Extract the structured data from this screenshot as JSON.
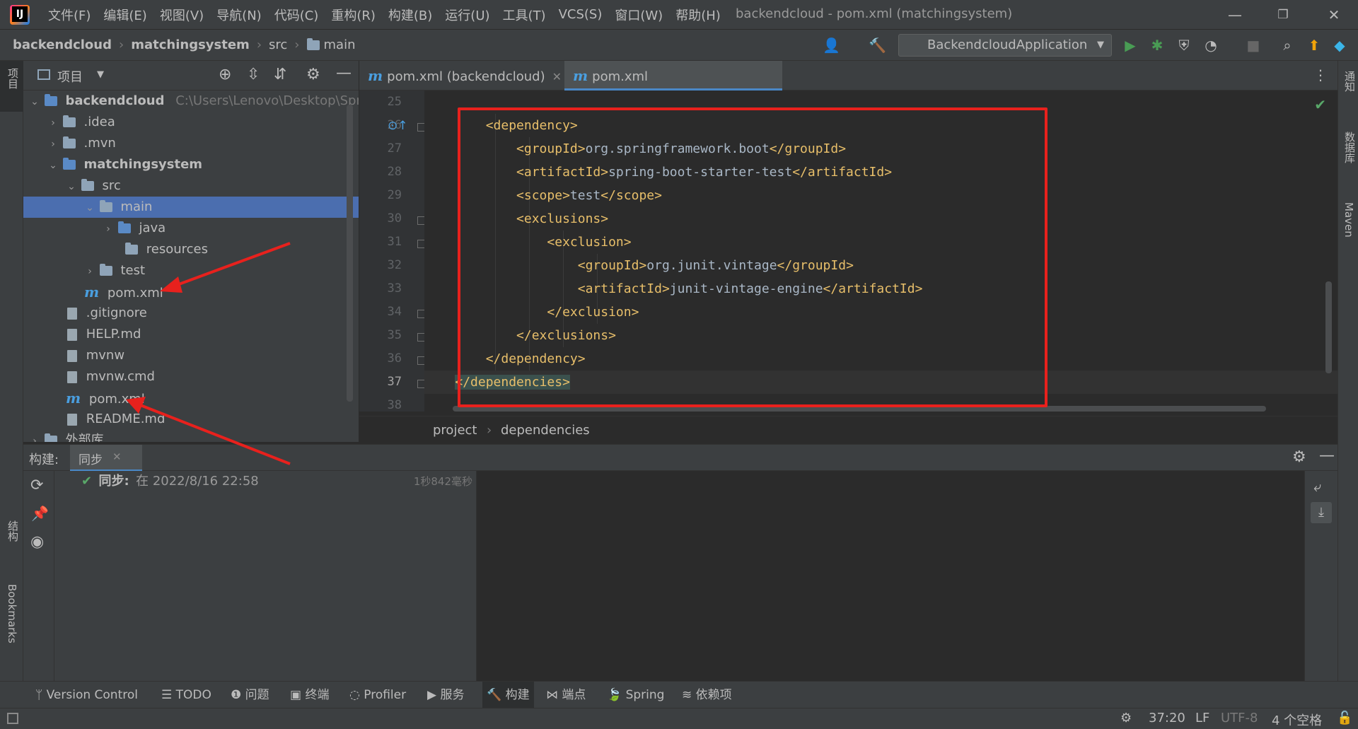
{
  "window": {
    "title": "backendcloud - pom.xml (matchingsystem)",
    "menu": [
      "文件(F)",
      "编辑(E)",
      "视图(V)",
      "导航(N)",
      "代码(C)",
      "重构(R)",
      "构建(B)",
      "运行(U)",
      "工具(T)",
      "VCS(S)",
      "窗口(W)",
      "帮助(H)"
    ],
    "controls": {
      "minimize": "—",
      "restore": "❐",
      "close": "✕"
    }
  },
  "navbar": {
    "crumbs": [
      "backendcloud",
      "matchingsystem",
      "src",
      "main"
    ],
    "run_config": "BackendcloudApplication"
  },
  "left_stripe": {
    "project": "项目",
    "structure": "结构",
    "bookmarks": "Bookmarks"
  },
  "right_stripe": {
    "notifications": "通知",
    "database": "数据库",
    "maven": "Maven"
  },
  "project_panel": {
    "title": "项目",
    "tree": [
      {
        "label": "backendcloud",
        "path": "C:\\Users\\Lenovo\\Desktop\\Spring"
      },
      {
        "label": ".idea"
      },
      {
        "label": ".mvn"
      },
      {
        "label": "matchingsystem"
      },
      {
        "label": "src"
      },
      {
        "label": "main"
      },
      {
        "label": "java"
      },
      {
        "label": "resources"
      },
      {
        "label": "test"
      },
      {
        "label": "pom.xml"
      },
      {
        "label": ".gitignore"
      },
      {
        "label": "HELP.md"
      },
      {
        "label": "mvnw"
      },
      {
        "label": "mvnw.cmd"
      },
      {
        "label": "pom.xml"
      },
      {
        "label": "README.md"
      },
      {
        "label": "外部库"
      }
    ]
  },
  "editor": {
    "tabs": [
      {
        "label": "pom.xml (backendcloud)"
      },
      {
        "label": "pom.xml (matchingsystem)"
      }
    ],
    "lines": [
      {
        "num": "25",
        "text": ""
      },
      {
        "num": "26",
        "text": "        <dependency>"
      },
      {
        "num": "27",
        "text": "            <groupId>org.springframework.boot</groupId>"
      },
      {
        "num": "28",
        "text": "            <artifactId>spring-boot-starter-test</artifactId>"
      },
      {
        "num": "29",
        "text": "            <scope>test</scope>"
      },
      {
        "num": "30",
        "text": "            <exclusions>"
      },
      {
        "num": "31",
        "text": "                <exclusion>"
      },
      {
        "num": "32",
        "text": "                    <groupId>org.junit.vintage</groupId>"
      },
      {
        "num": "33",
        "text": "                    <artifactId>junit-vintage-engine</artifactId>"
      },
      {
        "num": "34",
        "text": "                </exclusion>"
      },
      {
        "num": "35",
        "text": "            </exclusions>"
      },
      {
        "num": "36",
        "text": "        </dependency>"
      },
      {
        "num": "37",
        "text": "    </dependencies>"
      },
      {
        "num": "38",
        "text": ""
      }
    ],
    "breadcrumb": [
      "project",
      "dependencies"
    ]
  },
  "build_panel": {
    "label": "构建:",
    "tab": "同步",
    "sync_label": "同步:",
    "sync_time": "在 2022/8/16 22:58",
    "duration": "1秒842毫秒"
  },
  "bottom_tools": [
    "Version Control",
    "TODO",
    "问题",
    "终端",
    "Profiler",
    "服务",
    "构建",
    "端点",
    "Spring",
    "依赖项"
  ],
  "status": {
    "position": "37:20",
    "line_sep": "LF",
    "encoding": "UTF-8",
    "indent": "4 个空格"
  }
}
